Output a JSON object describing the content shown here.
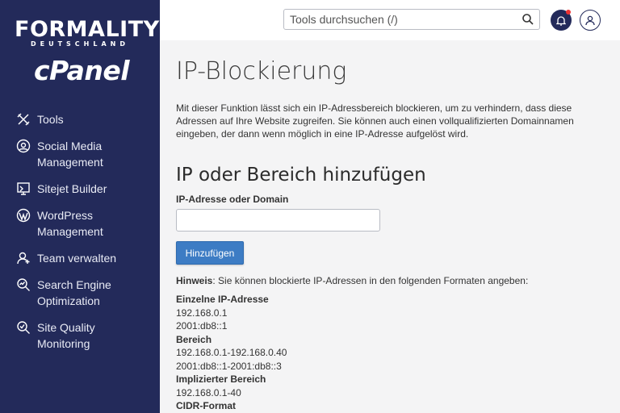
{
  "brand": {
    "name": "FORMALITY",
    "subtitle": "DEUTSCHLAND",
    "product": "cPanel"
  },
  "sidebar": {
    "items": [
      {
        "label": "Tools",
        "icon": "tools-icon"
      },
      {
        "label": "Social Media Management",
        "icon": "social-media-icon"
      },
      {
        "label": "Sitejet Builder",
        "icon": "sitejet-icon"
      },
      {
        "label": "WordPress Management",
        "icon": "wordpress-icon"
      },
      {
        "label": "Team verwalten",
        "icon": "team-icon"
      },
      {
        "label": "Search Engine Optimization",
        "icon": "seo-icon"
      },
      {
        "label": "Site Quality Monitoring",
        "icon": "site-quality-icon"
      }
    ]
  },
  "header": {
    "search_placeholder": "Tools durchsuchen (/)"
  },
  "page": {
    "title": "IP-Blockierung",
    "description": "Mit dieser Funktion lässt sich ein IP-Adressbereich blockieren, um zu verhindern, dass diese Adressen auf Ihre Website zugreifen. Sie können auch einen vollqualifizierten Domainnamen eingeben, der dann wenn möglich in eine IP-Adresse aufgelöst wird.",
    "section_title": "IP oder Bereich hinzufügen",
    "field_label": "IP-Adresse oder Domain",
    "field_value": "",
    "add_button": "Hinzufügen",
    "hint_label": "Hinweis",
    "hint_text": ": Sie können blockierte IP-Adressen in den folgenden Formaten angeben:",
    "formats": [
      {
        "heading": "Einzelne IP-Adresse",
        "examples": [
          "192.168.0.1",
          "2001:db8::1"
        ]
      },
      {
        "heading": "Bereich",
        "examples": [
          "192.168.0.1-192.168.0.40",
          "2001:db8::1-2001:db8::3"
        ]
      },
      {
        "heading": "Implizierter Bereich",
        "examples": [
          "192.168.0.1-40"
        ]
      },
      {
        "heading": "CIDR-Format",
        "examples": []
      }
    ]
  },
  "colors": {
    "sidebar_bg": "#232a5a",
    "button_bg": "#3d7cc4",
    "notification_dot": "#e33333"
  }
}
